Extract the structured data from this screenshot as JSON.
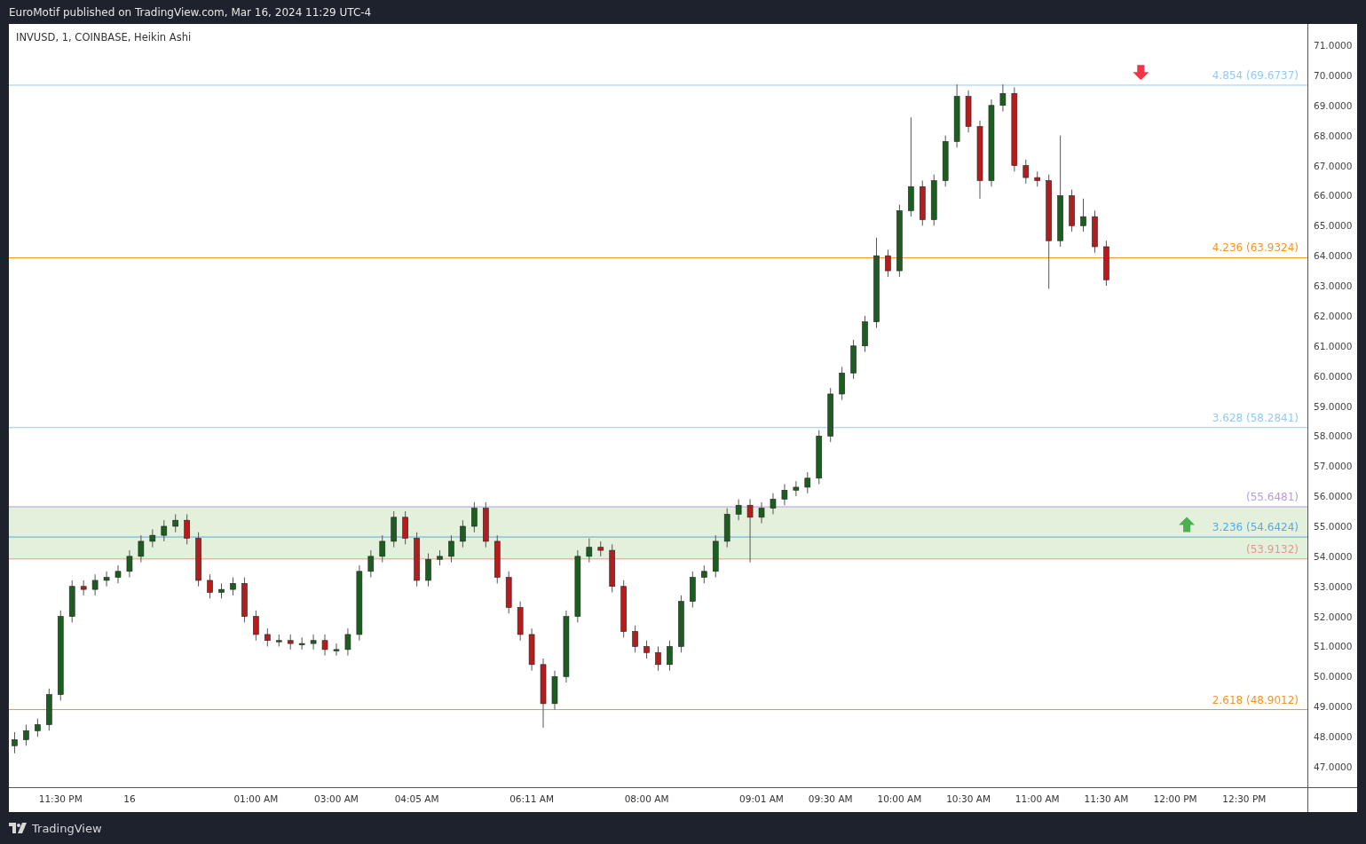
{
  "header": {
    "text": "EuroMotif published on TradingView.com, Mar 16, 2024 11:29 UTC-4"
  },
  "chart": {
    "chart_data": {
      "type": "candlestick",
      "title": "INVUSD, 1, COINBASE, Heikin Ashi",
      "categories": [
        null,
        null,
        null,
        null,
        "11:30 PM",
        null,
        null,
        null,
        null,
        null,
        "16",
        null,
        null,
        null,
        null,
        null,
        null,
        null,
        null,
        null,
        null,
        "01:00 AM",
        null,
        null,
        null,
        null,
        null,
        null,
        "03:00 AM",
        null,
        null,
        null,
        null,
        null,
        null,
        "04:05 AM",
        null,
        null,
        null,
        null,
        null,
        null,
        null,
        null,
        null,
        "06:11 AM",
        null,
        null,
        null,
        null,
        null,
        null,
        null,
        null,
        null,
        "08:00 AM",
        null,
        null,
        null,
        null,
        null,
        null,
        null,
        null,
        null,
        "09:01 AM",
        null,
        null,
        null,
        null,
        null,
        "09:30 AM",
        null,
        null,
        null,
        null,
        null,
        "10:00 AM",
        null,
        null,
        null,
        null,
        null,
        "10:30 AM",
        null,
        null,
        null,
        null,
        null,
        "11:00 AM",
        null,
        null,
        null,
        null,
        null,
        "11:30 AM",
        null,
        null,
        null,
        null,
        null,
        "12:00 PM",
        null,
        null,
        null,
        null,
        null,
        "12:30 PM",
        null,
        null,
        null,
        null,
        null
      ],
      "ohlc": [
        [
          47.7,
          48.15,
          47.45,
          47.9
        ],
        [
          47.9,
          48.4,
          47.7,
          48.2
        ],
        [
          48.2,
          48.6,
          48.0,
          48.4
        ],
        [
          48.4,
          49.6,
          48.2,
          49.4
        ],
        [
          49.4,
          52.2,
          49.2,
          52.0
        ],
        [
          52.0,
          53.2,
          51.8,
          53.0
        ],
        [
          53.0,
          53.2,
          52.7,
          52.9
        ],
        [
          52.9,
          53.4,
          52.7,
          53.2
        ],
        [
          53.2,
          53.5,
          53.0,
          53.3
        ],
        [
          53.3,
          53.7,
          53.1,
          53.5
        ],
        [
          53.5,
          54.2,
          53.3,
          54.0
        ],
        [
          54.0,
          54.7,
          53.8,
          54.5
        ],
        [
          54.5,
          54.9,
          54.3,
          54.7
        ],
        [
          54.7,
          55.2,
          54.5,
          55.0
        ],
        [
          55.0,
          55.4,
          54.8,
          55.2
        ],
        [
          55.2,
          55.4,
          54.4,
          54.6
        ],
        [
          54.6,
          54.8,
          53.0,
          53.2
        ],
        [
          53.2,
          53.4,
          52.6,
          52.8
        ],
        [
          52.8,
          53.1,
          52.6,
          52.9
        ],
        [
          52.9,
          53.3,
          52.7,
          53.1
        ],
        [
          53.1,
          53.3,
          51.8,
          52.0
        ],
        [
          52.0,
          52.2,
          51.2,
          51.4
        ],
        [
          51.4,
          51.6,
          51.0,
          51.2
        ],
        [
          51.2,
          51.4,
          51.0,
          51.2
        ],
        [
          51.2,
          51.4,
          50.9,
          51.1
        ],
        [
          51.1,
          51.3,
          50.9,
          51.1
        ],
        [
          51.1,
          51.4,
          50.9,
          51.2
        ],
        [
          51.2,
          51.4,
          50.7,
          50.9
        ],
        [
          50.9,
          51.1,
          50.7,
          50.9
        ],
        [
          50.9,
          51.6,
          50.7,
          51.4
        ],
        [
          51.4,
          53.7,
          51.2,
          53.5
        ],
        [
          53.5,
          54.2,
          53.3,
          54.0
        ],
        [
          54.0,
          54.7,
          53.8,
          54.5
        ],
        [
          54.5,
          55.5,
          54.3,
          55.3
        ],
        [
          55.3,
          55.5,
          54.4,
          54.6
        ],
        [
          54.6,
          54.8,
          53.0,
          53.2
        ],
        [
          53.2,
          54.1,
          53.0,
          53.9
        ],
        [
          53.9,
          54.2,
          53.7,
          54.0
        ],
        [
          54.0,
          54.7,
          53.8,
          54.5
        ],
        [
          54.5,
          55.2,
          54.3,
          55.0
        ],
        [
          55.0,
          55.8,
          54.8,
          55.6
        ],
        [
          55.6,
          55.8,
          54.3,
          54.5
        ],
        [
          54.5,
          54.7,
          53.1,
          53.3
        ],
        [
          53.3,
          53.5,
          52.1,
          52.3
        ],
        [
          52.3,
          52.5,
          51.2,
          51.4
        ],
        [
          51.4,
          51.6,
          50.2,
          50.4
        ],
        [
          50.4,
          50.6,
          48.3,
          49.1
        ],
        [
          49.1,
          50.2,
          48.9,
          50.0
        ],
        [
          50.0,
          52.2,
          49.8,
          52.0
        ],
        [
          52.0,
          54.2,
          51.8,
          54.0
        ],
        [
          54.0,
          54.6,
          53.8,
          54.3
        ],
        [
          54.3,
          54.5,
          54.0,
          54.2
        ],
        [
          54.2,
          54.4,
          52.8,
          53.0
        ],
        [
          53.0,
          53.2,
          51.3,
          51.5
        ],
        [
          51.5,
          51.7,
          50.8,
          51.0
        ],
        [
          51.0,
          51.2,
          50.6,
          50.8
        ],
        [
          50.8,
          51.0,
          50.2,
          50.4
        ],
        [
          50.4,
          51.2,
          50.2,
          51.0
        ],
        [
          51.0,
          52.7,
          50.8,
          52.5
        ],
        [
          52.5,
          53.5,
          52.3,
          53.3
        ],
        [
          53.3,
          53.7,
          53.1,
          53.5
        ],
        [
          53.5,
          54.7,
          53.3,
          54.5
        ],
        [
          54.5,
          55.6,
          54.3,
          55.4
        ],
        [
          55.4,
          55.9,
          55.2,
          55.7
        ],
        [
          55.7,
          55.9,
          53.8,
          55.3
        ],
        [
          55.3,
          55.8,
          55.1,
          55.6
        ],
        [
          55.6,
          56.1,
          55.4,
          55.9
        ],
        [
          55.9,
          56.4,
          55.7,
          56.2
        ],
        [
          56.2,
          56.5,
          56.0,
          56.3
        ],
        [
          56.3,
          56.8,
          56.1,
          56.6
        ],
        [
          56.6,
          58.2,
          56.4,
          58.0
        ],
        [
          58.0,
          59.6,
          57.8,
          59.4
        ],
        [
          59.4,
          60.3,
          59.2,
          60.1
        ],
        [
          60.1,
          61.2,
          59.9,
          61.0
        ],
        [
          61.0,
          62.0,
          60.8,
          61.8
        ],
        [
          61.8,
          64.6,
          61.6,
          64.0
        ],
        [
          64.0,
          64.2,
          63.3,
          63.5
        ],
        [
          63.5,
          65.7,
          63.3,
          65.5
        ],
        [
          65.5,
          68.6,
          65.3,
          66.3
        ],
        [
          66.3,
          66.5,
          65.0,
          65.2
        ],
        [
          65.2,
          66.7,
          65.0,
          66.5
        ],
        [
          66.5,
          68.0,
          66.3,
          67.8
        ],
        [
          67.8,
          69.7,
          67.6,
          69.3
        ],
        [
          69.3,
          69.5,
          68.1,
          68.3
        ],
        [
          68.3,
          68.5,
          65.9,
          66.5
        ],
        [
          66.5,
          69.2,
          66.3,
          69.0
        ],
        [
          69.0,
          69.7,
          68.8,
          69.4
        ],
        [
          69.4,
          69.6,
          66.8,
          67.0
        ],
        [
          67.0,
          67.2,
          66.4,
          66.6
        ],
        [
          66.6,
          66.8,
          66.3,
          66.5
        ],
        [
          66.5,
          66.7,
          62.9,
          64.5
        ],
        [
          64.5,
          68.0,
          64.3,
          66.0
        ],
        [
          66.0,
          66.2,
          64.8,
          65.0
        ],
        [
          65.0,
          65.9,
          64.8,
          65.3
        ],
        [
          65.3,
          65.5,
          64.1,
          64.3
        ],
        [
          64.3,
          64.5,
          63.0,
          63.2
        ],
        null,
        null,
        null,
        null,
        null,
        null,
        null,
        null,
        null,
        null,
        null,
        null,
        null,
        null,
        null,
        null,
        null
      ],
      "ylim": [
        46.32,
        71.71
      ],
      "yticks": [
        {
          "value": 47,
          "label": "47.0000"
        },
        {
          "value": 48,
          "label": "48.0000"
        },
        {
          "value": 49,
          "label": "49.0000"
        },
        {
          "value": 50,
          "label": "50.0000"
        },
        {
          "value": 51,
          "label": "51.0000"
        },
        {
          "value": 52,
          "label": "52.0000"
        },
        {
          "value": 53,
          "label": "53.0000"
        },
        {
          "value": 54,
          "label": "54.0000"
        },
        {
          "value": 55,
          "label": "55.0000"
        },
        {
          "value": 56,
          "label": "56.0000"
        },
        {
          "value": 57,
          "label": "57.0000"
        },
        {
          "value": 58,
          "label": "58.0000"
        },
        {
          "value": 59,
          "label": "59.0000"
        },
        {
          "value": 60,
          "label": "60.0000"
        },
        {
          "value": 61,
          "label": "61.0000"
        },
        {
          "value": 62,
          "label": "62.0000"
        },
        {
          "value": 63,
          "label": "63.0000"
        },
        {
          "value": 64,
          "label": "64.0000"
        },
        {
          "value": 65,
          "label": "65.0000"
        },
        {
          "value": 66,
          "label": "66.0000"
        },
        {
          "value": 67,
          "label": "67.0000"
        },
        {
          "value": 68,
          "label": "68.0000"
        },
        {
          "value": 69,
          "label": "69.0000"
        },
        {
          "value": 70,
          "label": "70.0000"
        },
        {
          "value": 71,
          "label": "71.0000"
        }
      ],
      "bands": [
        {
          "axis": "y",
          "from": 53.9132,
          "to": 55.6481,
          "color": "#e3f0dc"
        }
      ],
      "ref_lines": [
        {
          "axis": "y",
          "value": 69.6737,
          "label": "4.854 (69.6737)",
          "color": "#90caf9"
        },
        {
          "axis": "y",
          "value": 63.9324,
          "label": "4.236 (63.9324)",
          "color": "#f7931a"
        },
        {
          "axis": "y",
          "value": 58.2841,
          "label": "3.628 (58.2841)",
          "color": "#90caf9"
        },
        {
          "axis": "y",
          "value": 55.6481,
          "label": "(55.6481)",
          "color": "#b39ddb"
        },
        {
          "axis": "y",
          "value": 54.6424,
          "label": "3.236 (54.6424)",
          "color": "#5aa9de"
        },
        {
          "axis": "y",
          "value": 53.9132,
          "label": "(53.9132)",
          "color": "#e8958a"
        },
        {
          "axis": "y",
          "value": 48.9012,
          "label": "2.618 (48.9012)",
          "color": "#f7931a"
        }
      ]
    },
    "markers": [
      {
        "kind": "arrow-down",
        "color": "#f23645"
      },
      {
        "kind": "arrow-up",
        "color": "#4caf50"
      }
    ]
  },
  "footer": {
    "brand": "TradingView"
  }
}
